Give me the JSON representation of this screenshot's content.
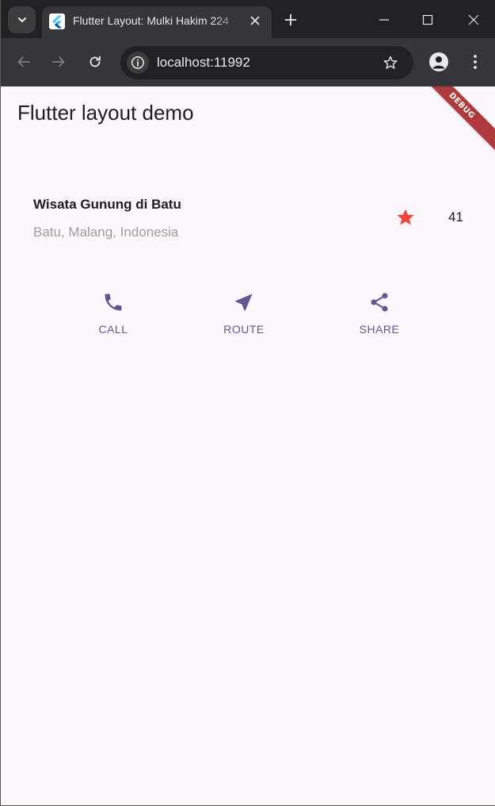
{
  "browser": {
    "tab_title": "Flutter Layout: Mulki Hakim 224",
    "url": "localhost:11992"
  },
  "app": {
    "title": "Flutter layout demo",
    "debug_banner": "DEBUG"
  },
  "title_section": {
    "name": "Wisata Gunung di Batu",
    "location": "Batu, Malang, Indonesia",
    "rating_count": "41"
  },
  "buttons": [
    {
      "label": "CALL",
      "icon": "phone-icon"
    },
    {
      "label": "ROUTE",
      "icon": "near-me-icon"
    },
    {
      "label": "SHARE",
      "icon": "share-icon"
    }
  ],
  "colors": {
    "accent": "#65558f",
    "star": "#f44336",
    "subtitle": "#9e9e9e",
    "background": "#fdf7fd",
    "debug_banner": "#b0393b"
  }
}
